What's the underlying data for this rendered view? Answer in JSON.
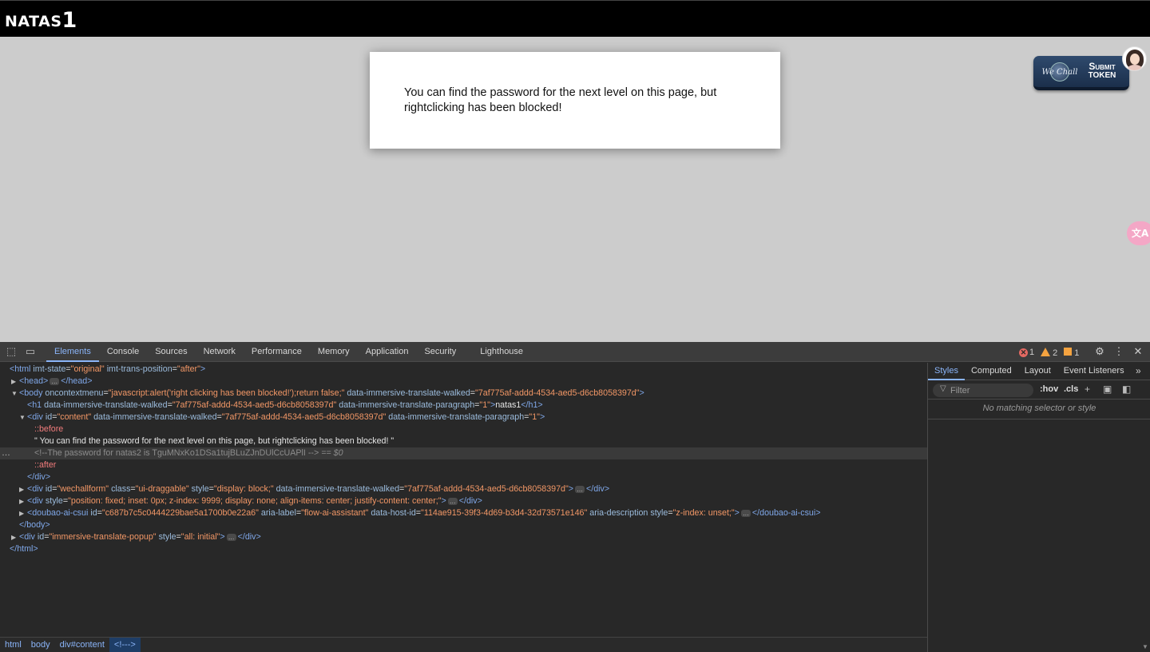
{
  "page": {
    "title_text": "NATAS",
    "title_num": "1",
    "content_text": "You can find the password for the next level on this page, but rightclicking has been blocked!",
    "wechall": {
      "logo_text": "We Chall",
      "label_line1": "Submit",
      "label_line2": "token"
    },
    "translate_icon": "文A"
  },
  "devtools": {
    "tabs": [
      "Elements",
      "Console",
      "Sources",
      "Network",
      "Performance",
      "Memory",
      "Application",
      "Security",
      "Lighthouse"
    ],
    "active_tab": "Elements",
    "status": {
      "errors": "1",
      "warnings": "2",
      "issues": "1"
    },
    "dom": {
      "l1_tag": "<html",
      "l1_a1": "imt-state",
      "l1_v1": "\"original\"",
      "l1_a2": "imt-trans-position",
      "l1_v2": "\"after\"",
      "l1_end": ">",
      "l2_open": "<head>",
      "l2_close": "</head>",
      "l3_tag": "<body",
      "l3_a1": "oncontextmenu",
      "l3_v1": "\"javascript:alert('right clicking has been blocked!');return false;\"",
      "l3_a2": "data-immersive-translate-walked",
      "l3_v2": "\"7af775af-addd-4534-aed5-d6cb8058397d\"",
      "l3_end": ">",
      "l4_tag": "<h1",
      "l4_a1": "data-immersive-translate-walked",
      "l4_v1": "\"7af775af-addd-4534-aed5-d6cb8058397d\"",
      "l4_a2": "data-immersive-translate-paragraph",
      "l4_v2": "\"1\"",
      "l4_gt": ">",
      "l4_text": "natas1",
      "l4_close": "</h1>",
      "l5_tag": "<div",
      "l5_a1": "id",
      "l5_v1": "\"content\"",
      "l5_a2": "data-immersive-translate-walked",
      "l5_v2": "\"7af775af-addd-4534-aed5-d6cb8058397d\"",
      "l5_a3": "data-immersive-translate-paragraph",
      "l5_v3": "\"1\"",
      "l5_end": ">",
      "l6_pseudo": "::before",
      "l7_text": "\" You can find the password for the next level on this page, but rightclicking has been blocked! \"",
      "l8_comment": "<!--The password for natas2 is TguMNxKo1DSa1tujBLuZJnDUlCcUAPlI -->",
      "l8_eq": "== $0",
      "l9_pseudo": "::after",
      "l10_close": "</div>",
      "l11_tag": "<div",
      "l11_a1": "id",
      "l11_v1": "\"wechallform\"",
      "l11_a2": "class",
      "l11_v2": "\"ui-draggable\"",
      "l11_a3": "style",
      "l11_v3": "\"display: block;\"",
      "l11_a4": "data-immersive-translate-walked",
      "l11_v4": "\"7af775af-addd-4534-aed5-d6cb8058397d\"",
      "l11_gt": ">",
      "l11_close": "</div>",
      "l12_tag": "<div",
      "l12_a1": "style",
      "l12_v1": "\"position: fixed; inset: 0px; z-index: 9999; display: none; align-items: center; justify-content: center;\"",
      "l12_gt": ">",
      "l12_close": "</div>",
      "l13_tag": "<doubao-ai-csui",
      "l13_a1": "id",
      "l13_v1": "\"c687b7c5c0444229bae5a1700b0e22a6\"",
      "l13_a2": "aria-label",
      "l13_v2": "\"flow-ai-assistant\"",
      "l13_a3": "data-host-id",
      "l13_v3": "\"114ae915-39f3-4d69-b3d4-32d73571e146\"",
      "l13_a4": "aria-description",
      "l13_a5": "style",
      "l13_v5": "\"z-index: unset;\"",
      "l13_gt": ">",
      "l13_close": "</doubao-ai-csui>",
      "l14_close": "</body>",
      "l15_tag": "<div",
      "l15_a1": "id",
      "l15_v1": "\"immersive-translate-popup\"",
      "l15_a2": "style",
      "l15_v2": "\"all: initial\"",
      "l15_gt": ">",
      "l15_close": "</div>",
      "l16_close": "</html>",
      "ellipsis": "…"
    },
    "breadcrumb": [
      "html",
      "body",
      "div#content",
      "<!--->"
    ],
    "styles": {
      "tabs": [
        "Styles",
        "Computed",
        "Layout",
        "Event Listeners"
      ],
      "filter_placeholder": "Filter",
      "hov": ":hov",
      "cls": ".cls",
      "no_match": "No matching selector or style"
    }
  },
  "colors": {
    "page_bg": "#cccccc",
    "header_bg": "#000000",
    "devtools_bg": "#282828",
    "accent": "#8ab4f8",
    "attr_value": "#f29766"
  }
}
